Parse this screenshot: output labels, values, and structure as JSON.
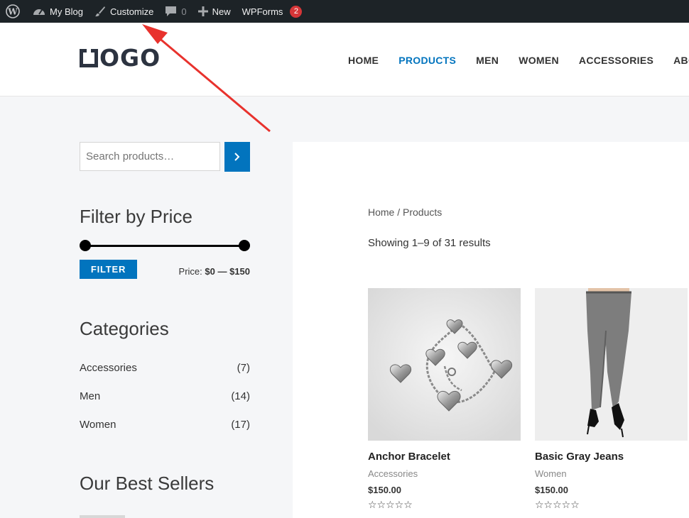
{
  "adminbar": {
    "wp_icon": "wordpress-icon",
    "site_name": "My Blog",
    "customize": "Customize",
    "comments_count": "0",
    "new": "New",
    "wpforms": "WPForms",
    "wpforms_badge": "2"
  },
  "header": {
    "logo_text": "OGO",
    "nav": [
      "HOME",
      "PRODUCTS",
      "MEN",
      "WOMEN",
      "ACCESSORIES",
      "ABO"
    ],
    "active_nav": "PRODUCTS"
  },
  "sidebar": {
    "search_placeholder": "Search products…",
    "filter_title": "Filter by Price",
    "filter_button": "FILTER",
    "price_prefix": "Price:",
    "price_range": "$0 — $150",
    "categories_title": "Categories",
    "categories": [
      {
        "name": "Accessories",
        "count": "(7)"
      },
      {
        "name": "Men",
        "count": "(14)"
      },
      {
        "name": "Women",
        "count": "(17)"
      }
    ],
    "best_sellers_title": "Our Best Sellers"
  },
  "main": {
    "breadcrumb": "Home / Products",
    "results": "Showing 1–9 of 31 results",
    "products": [
      {
        "name": "Anchor Bracelet",
        "category": "Accessories",
        "price": "$150.00",
        "stars": "☆☆☆☆☆"
      },
      {
        "name": "Basic Gray Jeans",
        "category": "Women",
        "price": "$150.00",
        "stars": "☆☆☆☆☆"
      }
    ]
  },
  "colors": {
    "accent": "#0274be",
    "adminbar": "#1d2327",
    "annotation_arrow": "#e8322d"
  }
}
